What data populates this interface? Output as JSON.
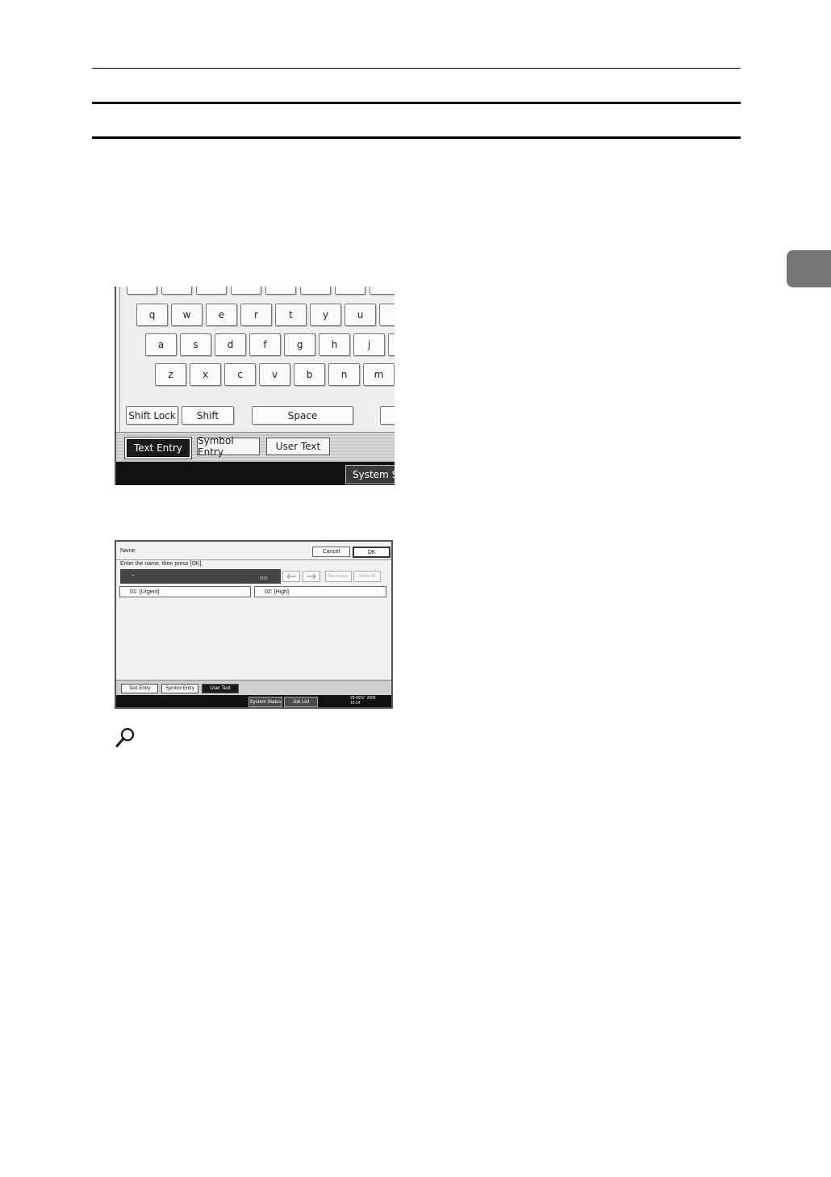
{
  "keyboard_screen": {
    "keys_row1": [
      "q",
      "w",
      "e",
      "r",
      "t",
      "y",
      "u"
    ],
    "keys_row2": [
      "a",
      "s",
      "d",
      "f",
      "g",
      "h",
      "j"
    ],
    "keys_row3": [
      "z",
      "x",
      "c",
      "v",
      "b",
      "n",
      "m"
    ],
    "shift_lock_label": "Shift Lock",
    "shift_label": "Shift",
    "space_label": "Space",
    "tabs": [
      "Text Entry",
      "Symbol Entry",
      "User Text"
    ],
    "active_tab": "Text Entry",
    "system_status_label": "System Statu"
  },
  "name_screen": {
    "title": "Name",
    "cancel_label": "Cancel",
    "ok_label": "OK",
    "instruction": "Enter the name, then press [OK].",
    "field_value": "–",
    "char_count": "0/20",
    "backspace_label": "Backspace",
    "delete_all_label": "Delete All",
    "user_text_items": [
      "01: [Urgent]",
      "02: [High]"
    ],
    "tabs": [
      "Text Entry",
      "Symbol Entry",
      "User Text"
    ],
    "active_tab": "User Text",
    "system_status_label": "System Status",
    "job_list_label": "Job List",
    "date": "29 NOV  2005",
    "time": "15:14"
  },
  "icons": {
    "reference": "magnifier-icon",
    "cursor_left": "arrow-left-icon",
    "cursor_right": "arrow-right-icon"
  }
}
